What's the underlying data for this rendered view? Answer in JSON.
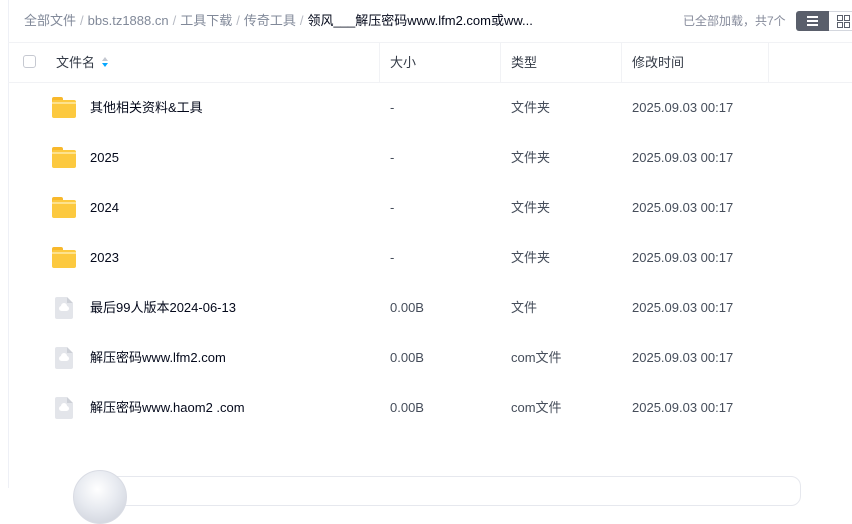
{
  "breadcrumb": {
    "items": [
      "全部文件",
      "bbs.tz1888.cn",
      "工具下载",
      "传奇工具"
    ],
    "current": "领风___解压密码www.lfm2.com或ww...",
    "separator": "/"
  },
  "status": {
    "text": "已全部加载，共7个"
  },
  "view_toggle": {
    "list_icon": "list-view-icon",
    "grid_icon": "grid-view-icon",
    "active": "list"
  },
  "table": {
    "columns": {
      "name": "文件名",
      "size": "大小",
      "type": "类型",
      "time": "修改时间"
    },
    "sort": {
      "column": "name",
      "icon": "sort-icon"
    },
    "rows": [
      {
        "icon": "folder-icon",
        "name": "其他相关资料&工具",
        "size": "-",
        "type": "文件夹",
        "time": "2025.09.03 00:17"
      },
      {
        "icon": "folder-icon",
        "name": "2025",
        "size": "-",
        "type": "文件夹",
        "time": "2025.09.03 00:17"
      },
      {
        "icon": "folder-icon",
        "name": "2024",
        "size": "-",
        "type": "文件夹",
        "time": "2025.09.03 00:17"
      },
      {
        "icon": "folder-icon",
        "name": "2023",
        "size": "-",
        "type": "文件夹",
        "time": "2025.09.03 00:17"
      },
      {
        "icon": "file-icon",
        "name": "最后99人版本2024-06-13",
        "size": "0.00B",
        "type": "文件",
        "time": "2025.09.03 00:17"
      },
      {
        "icon": "file-icon",
        "name": "解压密码www.lfm2.com",
        "size": "0.00B",
        "type": "com文件",
        "time": "2025.09.03 00:17"
      },
      {
        "icon": "file-icon",
        "name": "解压密码www.haom2 .com",
        "size": "0.00B",
        "type": "com文件",
        "time": "2025.09.03 00:17"
      }
    ]
  },
  "colors": {
    "accent": "#06a7ff",
    "folder": "#fcc93f",
    "view_active_bg": "#5a5f6b"
  }
}
